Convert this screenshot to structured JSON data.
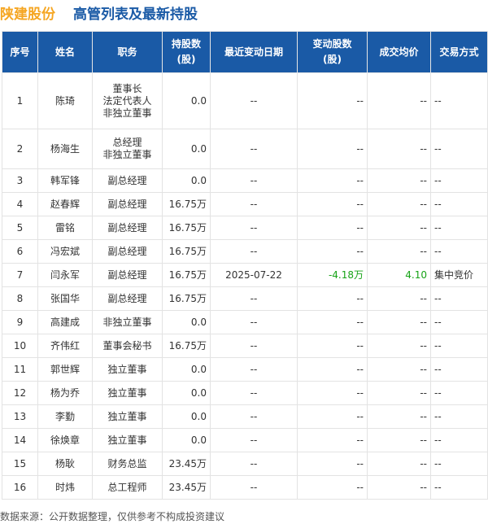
{
  "header": {
    "company": "陕建股份",
    "title": "高管列表及最新持股"
  },
  "table": {
    "columns": [
      "序号",
      "姓名",
      "职务",
      "持股数\n(股)",
      "最近变动日期",
      "变动股数\n(股)",
      "成交均价",
      "交易方式"
    ],
    "rows": [
      {
        "no": "1",
        "name": "陈琦",
        "role": "董事长\n法定代表人\n非独立董事",
        "shares": "0.0",
        "date": "--",
        "change": "--",
        "price": "--",
        "method": "--"
      },
      {
        "no": "2",
        "name": "杨海生",
        "role": "总经理\n非独立董事",
        "shares": "0.0",
        "date": "--",
        "change": "--",
        "price": "--",
        "method": "--"
      },
      {
        "no": "3",
        "name": "韩军锋",
        "role": "副总经理",
        "shares": "0.0",
        "date": "--",
        "change": "--",
        "price": "--",
        "method": "--"
      },
      {
        "no": "4",
        "name": "赵春辉",
        "role": "副总经理",
        "shares": "16.75万",
        "date": "--",
        "change": "--",
        "price": "--",
        "method": "--"
      },
      {
        "no": "5",
        "name": "雷铭",
        "role": "副总经理",
        "shares": "16.75万",
        "date": "--",
        "change": "--",
        "price": "--",
        "method": "--"
      },
      {
        "no": "6",
        "name": "冯宏斌",
        "role": "副总经理",
        "shares": "16.75万",
        "date": "--",
        "change": "--",
        "price": "--",
        "method": "--"
      },
      {
        "no": "7",
        "name": "闫永军",
        "role": "副总经理",
        "shares": "16.75万",
        "date": "2025-07-22",
        "change": "-4.18万",
        "price": "4.10",
        "method": "集中竞价"
      },
      {
        "no": "8",
        "name": "张国华",
        "role": "副总经理",
        "shares": "16.75万",
        "date": "--",
        "change": "--",
        "price": "--",
        "method": "--"
      },
      {
        "no": "9",
        "name": "高建成",
        "role": "非独立董事",
        "shares": "0.0",
        "date": "--",
        "change": "--",
        "price": "--",
        "method": "--"
      },
      {
        "no": "10",
        "name": "齐伟红",
        "role": "董事会秘书",
        "shares": "16.75万",
        "date": "--",
        "change": "--",
        "price": "--",
        "method": "--"
      },
      {
        "no": "11",
        "name": "郭世辉",
        "role": "独立董事",
        "shares": "0.0",
        "date": "--",
        "change": "--",
        "price": "--",
        "method": "--"
      },
      {
        "no": "12",
        "name": "杨为乔",
        "role": "独立董事",
        "shares": "0.0",
        "date": "--",
        "change": "--",
        "price": "--",
        "method": "--"
      },
      {
        "no": "13",
        "name": "李勤",
        "role": "独立董事",
        "shares": "0.0",
        "date": "--",
        "change": "--",
        "price": "--",
        "method": "--"
      },
      {
        "no": "14",
        "name": "徐焕章",
        "role": "独立董事",
        "shares": "0.0",
        "date": "--",
        "change": "--",
        "price": "--",
        "method": "--"
      },
      {
        "no": "15",
        "name": "杨耿",
        "role": "财务总监",
        "shares": "23.45万",
        "date": "--",
        "change": "--",
        "price": "--",
        "method": "--"
      },
      {
        "no": "16",
        "name": "时炜",
        "role": "总工程师",
        "shares": "23.45万",
        "date": "--",
        "change": "--",
        "price": "--",
        "method": "--"
      }
    ]
  },
  "footer": {
    "source": "数据来源：公开数据整理，仅供参考不构成投资建议"
  },
  "colors": {
    "header_bg": "#1a5aa6",
    "company": "#f5a623",
    "positive_change": "#17a317"
  }
}
